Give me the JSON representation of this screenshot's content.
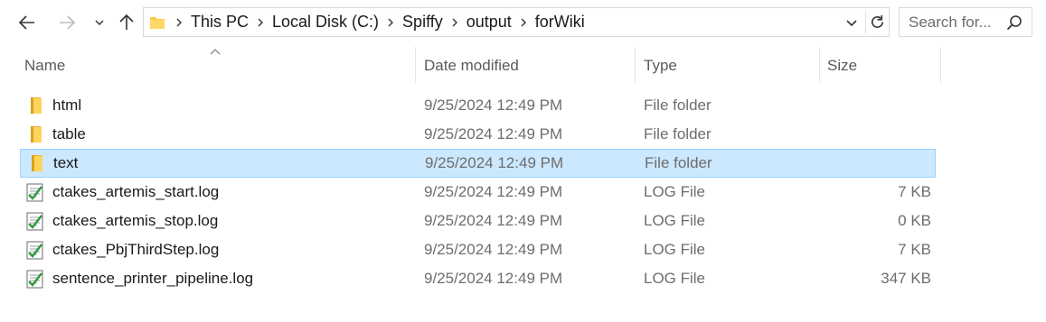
{
  "nav": {
    "back_icon": "arrow-left-icon",
    "forward_icon": "arrow-right-icon",
    "recent_icon": "chevron-down-icon",
    "up_icon": "arrow-up-icon"
  },
  "address": {
    "crumbs": [
      "This PC",
      "Local Disk (C:)",
      "Spiffy",
      "output",
      "forWiki"
    ],
    "dropdown_icon": "chevron-down-icon",
    "refresh_icon": "refresh-icon"
  },
  "search": {
    "placeholder": "Search for...",
    "icon": "search-icon"
  },
  "columns": {
    "name": "Name",
    "date": "Date modified",
    "type": "Type",
    "size": "Size",
    "sort_icon": "sort-ascending-icon"
  },
  "files": [
    {
      "name": "html",
      "date": "9/25/2024 12:49 PM",
      "type": "File folder",
      "size": "",
      "icon": "folder-icon"
    },
    {
      "name": "table",
      "date": "9/25/2024 12:49 PM",
      "type": "File folder",
      "size": "",
      "icon": "folder-icon"
    },
    {
      "name": "text",
      "date": "9/25/2024 12:49 PM",
      "type": "File folder",
      "size": "",
      "icon": "folder-icon",
      "selected": true
    },
    {
      "name": "ctakes_artemis_start.log",
      "date": "9/25/2024 12:49 PM",
      "type": "LOG File",
      "size": "7 KB",
      "icon": "log-file-icon"
    },
    {
      "name": "ctakes_artemis_stop.log",
      "date": "9/25/2024 12:49 PM",
      "type": "LOG File",
      "size": "0 KB",
      "icon": "log-file-icon"
    },
    {
      "name": "ctakes_PbjThirdStep.log",
      "date": "9/25/2024 12:49 PM",
      "type": "LOG File",
      "size": "7 KB",
      "icon": "log-file-icon"
    },
    {
      "name": "sentence_printer_pipeline.log",
      "date": "9/25/2024 12:49 PM",
      "type": "LOG File",
      "size": "347 KB",
      "icon": "log-file-icon"
    }
  ],
  "colors": {
    "selection_bg": "#cce8ff",
    "selection_border": "#99d1ff",
    "folder_yellow": "#f8c84a"
  }
}
